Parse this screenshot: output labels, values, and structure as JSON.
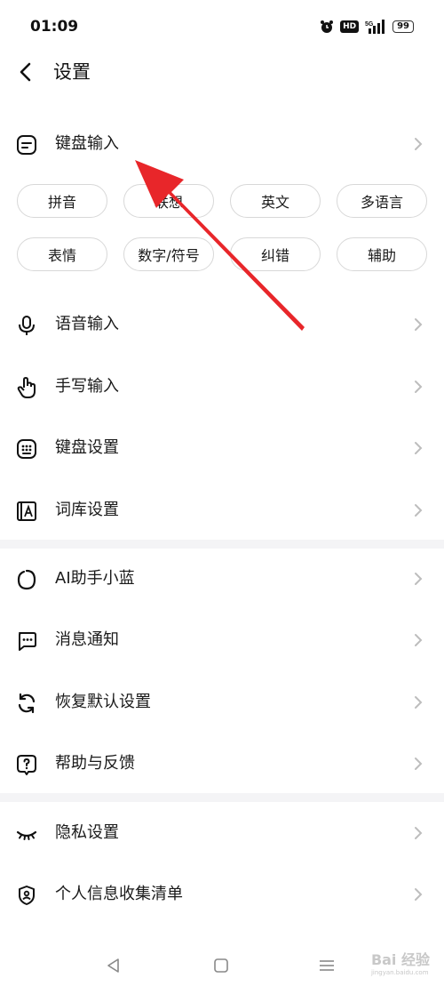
{
  "status_bar": {
    "time": "01:09",
    "hd_label": "HD",
    "network_label": "5G",
    "battery": "99"
  },
  "header": {
    "title": "设置"
  },
  "keyboard_input": {
    "label": "键盘输入",
    "chips": [
      "拼音",
      "联想",
      "英文",
      "多语言",
      "表情",
      "数字/符号",
      "纠错",
      "辅助"
    ]
  },
  "section1": [
    {
      "label": "语音输入",
      "icon": "microphone-icon"
    },
    {
      "label": "手写输入",
      "icon": "hand-pointer-icon"
    },
    {
      "label": "键盘设置",
      "icon": "keyboard-icon"
    },
    {
      "label": "词库设置",
      "icon": "dictionary-icon"
    }
  ],
  "section2": [
    {
      "label": "AI助手小蓝",
      "icon": "ai-assistant-icon"
    },
    {
      "label": "消息通知",
      "icon": "message-icon"
    },
    {
      "label": "恢复默认设置",
      "icon": "restore-icon"
    },
    {
      "label": "帮助与反馈",
      "icon": "help-icon"
    }
  ],
  "section3": [
    {
      "label": "隐私设置",
      "icon": "eye-closed-icon"
    },
    {
      "label": "个人信息收集清单",
      "icon": "shield-user-icon"
    }
  ],
  "watermark": {
    "brand": "Bai 经验",
    "url": "jingyan.baidu.com"
  },
  "annotation": {
    "color": "#e8262a"
  }
}
